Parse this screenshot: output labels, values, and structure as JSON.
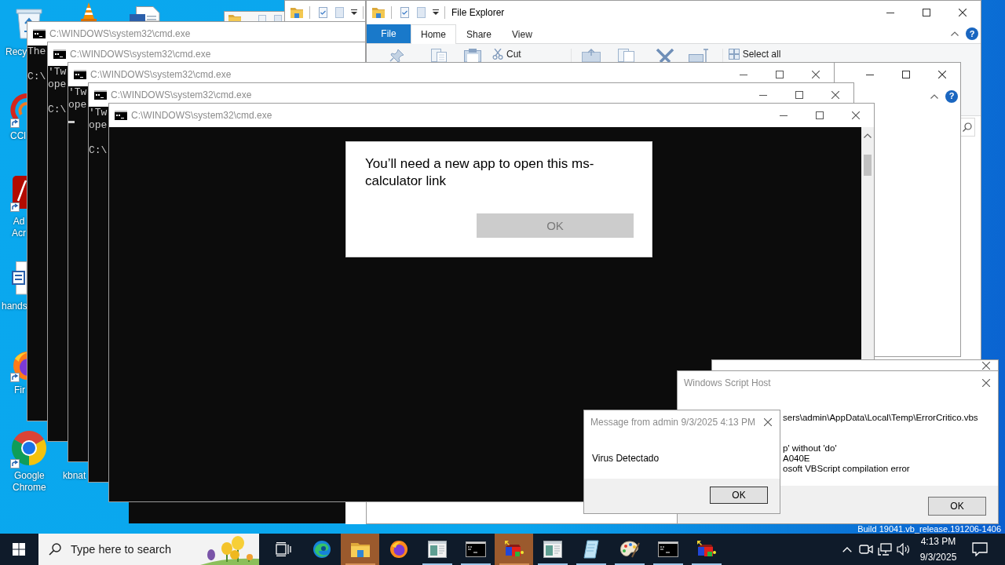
{
  "desktop_icons": [
    {
      "kind": "recycle_bin",
      "label": "Recy"
    },
    {
      "kind": "cone"
    },
    {
      "kind": "document"
    },
    {
      "kind": "swirl",
      "label": "CCl"
    },
    {
      "kind": "tile",
      "label": "Ad Acr"
    },
    {
      "kind": "word_document",
      "label": "hands"
    },
    {
      "kind": "flame_globe",
      "label": "Fir"
    },
    {
      "kind": "ring",
      "label": "Google Chrome"
    },
    {
      "label": "kbnat"
    }
  ],
  "cmd_windows": [
    {
      "title": "C:\\WINDOWS\\system32\\cmd.exe",
      "blocks": [
        [
          "The"
        ],
        [
          "C:\\"
        ]
      ],
      "cursor": false
    },
    {
      "title": "C:\\WINDOWS\\system32\\cmd.exe",
      "blocks": [
        [
          "'Tw",
          "ope"
        ],
        [
          "C:\\"
        ]
      ],
      "cursor": false
    },
    {
      "title": "C:\\WINDOWS\\system32\\cmd.exe",
      "blocks": [
        [
          "'Tw",
          "ope"
        ]
      ],
      "cursor": true
    },
    {
      "title": "C:\\WINDOWS\\system32\\cmd.exe",
      "blocks": [
        [
          "'Tw",
          "ope"
        ],
        [
          "C:\\"
        ]
      ],
      "cursor": false
    },
    {
      "title": "C:\\WINDOWS\\system32\\cmd.exe",
      "cursor": false
    }
  ],
  "explorer": {
    "title": "File Explorer",
    "tabs": [
      {
        "label": "File",
        "kind": "menu",
        "selected": false
      },
      {
        "label": "Home",
        "kind": "tab",
        "selected": true
      },
      {
        "label": "Share",
        "kind": "tab",
        "selected": false
      },
      {
        "label": "View",
        "kind": "tab",
        "selected": false
      }
    ],
    "help": "?",
    "ribbon": [
      {
        "kind": "pin"
      },
      {
        "kind": "copy"
      },
      {
        "kind": "paste"
      },
      {
        "kind": "cut",
        "label": "Cut"
      },
      {
        "kind": "move"
      },
      {
        "kind": "copy_to"
      },
      {
        "kind": "delete"
      },
      {
        "kind": "rename"
      },
      {
        "kind": "select_all",
        "label": "Select all"
      }
    ]
  },
  "second_explorer": {
    "help": "?"
  },
  "app_prompt": {
    "message": "You’ll need a new app to open this ms-calculator link",
    "button": {
      "label": "OK",
      "disabled": true
    }
  },
  "script_error": {
    "title": "Windows Script Host",
    "blocks": [
      [
        "sers\\admin\\AppData\\Local\\Temp\\ErrorCritico.vbs"
      ],
      [
        "p' without 'do'",
        "A040E",
        "osoft VBScript compilation error"
      ]
    ],
    "button": "OK"
  },
  "build_info": "Build 19041.vb_release.191206-1406",
  "message_box": {
    "title": "Message from admin 9/3/2025 4:13 PM",
    "message": "Virus Detectado",
    "button": "OK"
  },
  "taskbar": {
    "search": {
      "placeholder": "Type here to search"
    },
    "apps": [
      {
        "kind": "task_view",
        "flashing": false,
        "running": false
      },
      {
        "kind": "swirl",
        "flashing": false,
        "running": false
      },
      {
        "kind": "folder",
        "flashing": true,
        "running": true
      },
      {
        "kind": "flame_globe",
        "flashing": false,
        "running": false
      },
      {
        "kind": "app_window",
        "flashing": false,
        "running": true
      },
      {
        "kind": "terminal",
        "flashing": false,
        "running": true
      },
      {
        "kind": "cubes",
        "flashing": true,
        "running": true
      },
      {
        "kind": "app_window",
        "flashing": false,
        "running": true
      },
      {
        "kind": "notepad",
        "flashing": false,
        "running": true
      },
      {
        "kind": "palette",
        "flashing": false,
        "running": true
      },
      {
        "kind": "terminal",
        "flashing": false,
        "running": true
      },
      {
        "kind": "cubes",
        "flashing": false,
        "running": true
      }
    ],
    "tray": {
      "time": "4:13 PM",
      "date": "9/3/2025"
    }
  }
}
